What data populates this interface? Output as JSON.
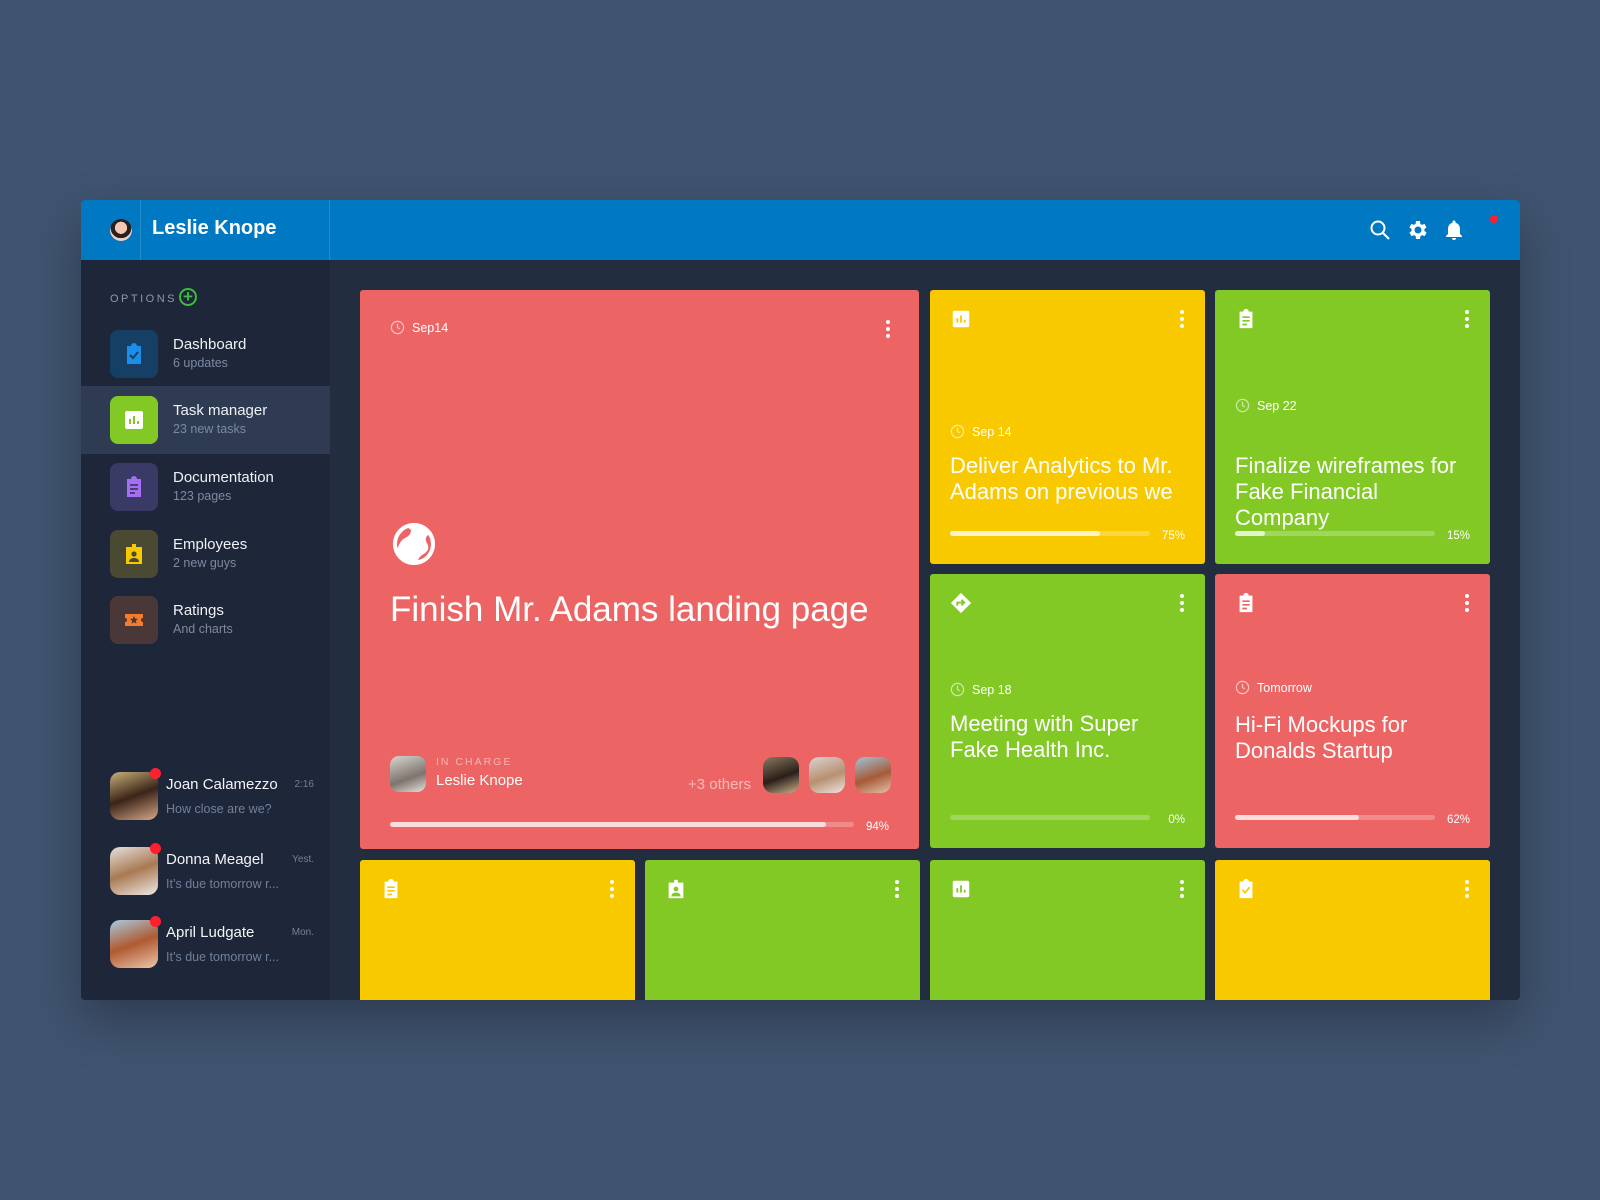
{
  "header": {
    "user_name": "Leslie Knope",
    "icons": [
      "search-icon",
      "gear-icon",
      "bell-icon"
    ],
    "accent": "#0079c2"
  },
  "sidebar": {
    "options_label": "OPTIONS",
    "items": [
      {
        "label": "Dashboard",
        "sub": "6 updates",
        "icon": "clipboard-check-icon",
        "color": "#1a8ee8",
        "bg": "#163f66"
      },
      {
        "label": "Task manager",
        "sub": "23 new tasks",
        "icon": "bar-chart-icon",
        "color": "#ffffff",
        "bg": "#82c926",
        "active": true
      },
      {
        "label": "Documentation",
        "sub": "123 pages",
        "icon": "clipboard-text-icon",
        "color": "#a66ef3",
        "bg": "#3a3a66"
      },
      {
        "label": "Employees",
        "sub": "2 new guys",
        "icon": "badge-icon",
        "color": "#f9c900",
        "bg": "#4a4a33"
      },
      {
        "label": "Ratings",
        "sub": "And charts",
        "icon": "ticket-star-icon",
        "color": "#f57a29",
        "bg": "#4a3838"
      }
    ],
    "chats": [
      {
        "name": "Joan Calamezzo",
        "message": "How close are we?",
        "time": "2:16"
      },
      {
        "name": "Donna Meagel",
        "message": "It’s due tomorrow r...",
        "time": "Yest."
      },
      {
        "name": "April Ludgate",
        "message": "It’s due tomorrow r...",
        "time": "Mon."
      }
    ]
  },
  "featured": {
    "date": "Sep14",
    "title": "Finish Mr. Adams landing page",
    "icon": "globe-icon",
    "in_charge_label": "IN CHARGE",
    "in_charge_name": "Leslie Knope",
    "others": "+3 others",
    "progress": 94,
    "progress_label": "94%"
  },
  "cards": [
    {
      "icon": "bar-chart-icon",
      "date": "Sep 14",
      "title": "Deliver Analytics to Mr. Adams on previous we",
      "progress": 75,
      "progress_label": "75%",
      "color": "yellow"
    },
    {
      "icon": "clipboard-text-icon",
      "date": "Sep 22",
      "title": "Finalize wireframes for Fake Financial Company",
      "progress": 15,
      "progress_label": "15%",
      "color": "green"
    },
    {
      "icon": "directions-icon",
      "date": "Sep 18",
      "title": "Meeting with Super Fake Health Inc.",
      "progress": 0,
      "progress_label": "0%",
      "color": "green"
    },
    {
      "icon": "clipboard-text-icon",
      "date": "Tomorrow",
      "title": "Hi-Fi Mockups for Donalds Startup",
      "progress": 62,
      "progress_label": "62%",
      "color": "red"
    },
    {
      "icon": "clipboard-text-icon",
      "color": "yellow"
    },
    {
      "icon": "badge-icon",
      "color": "green"
    },
    {
      "icon": "bar-chart-icon",
      "color": "green"
    },
    {
      "icon": "clipboard-check-icon",
      "color": "yellow"
    }
  ]
}
